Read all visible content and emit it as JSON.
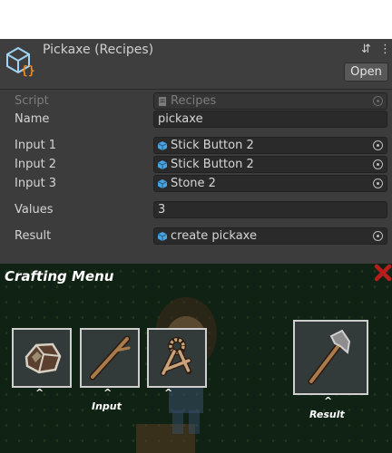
{
  "inspector": {
    "title": "Pickaxe (Recipes)",
    "open_label": "Open",
    "settings_icon": "sliders-icon",
    "menu_icon": "kebab-menu-icon",
    "fields": {
      "script": {
        "label": "Script",
        "value": "Recipes"
      },
      "name": {
        "label": "Name",
        "value": "pickaxe"
      },
      "input1": {
        "label": "Input 1",
        "value": "Stick Button 2"
      },
      "input2": {
        "label": "Input 2",
        "value": "Stick Button 2"
      },
      "input3": {
        "label": "Input 3",
        "value": "Stone 2"
      },
      "values": {
        "label": "Values",
        "value": "3"
      },
      "result": {
        "label": "Result",
        "value": "create pickaxe"
      }
    },
    "colors": {
      "prefab_icon": "#4aa3df",
      "asset_icon_orange": "#e98a2b"
    }
  },
  "game": {
    "title": "Crafting Menu",
    "close_color": "#b81d1d",
    "slots": [
      {
        "item": "stone-icon",
        "caret": "^"
      },
      {
        "item": "stick-icon",
        "caret": "^"
      },
      {
        "item": "rope-icon",
        "caret": "^"
      }
    ],
    "result_slot": {
      "item": "pickaxe-icon",
      "caret": "^"
    },
    "input_label": "Input",
    "result_label": "Result"
  }
}
